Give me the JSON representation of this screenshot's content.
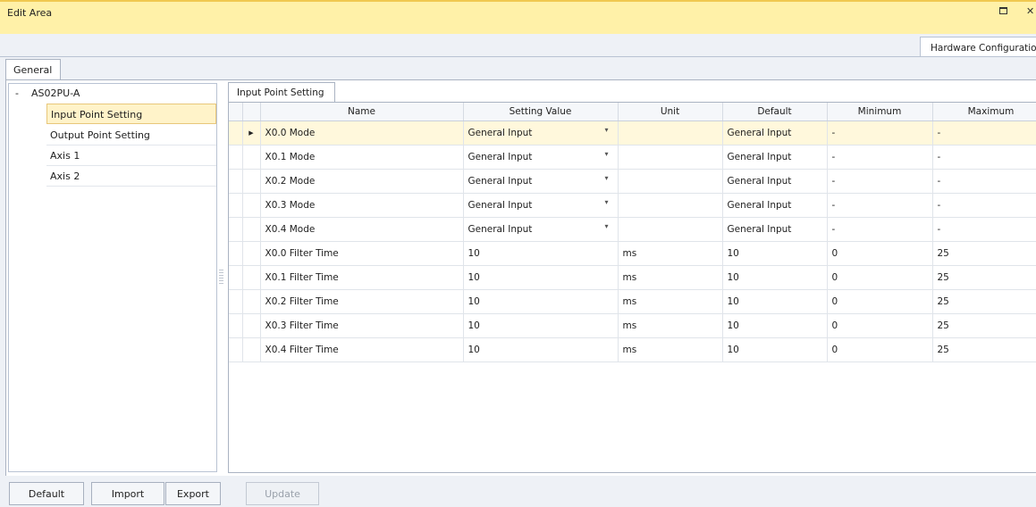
{
  "window": {
    "title": "Edit Area"
  },
  "area_tab": {
    "label": "Hardware Configuration"
  },
  "tabs": {
    "general": "General",
    "grid": "Input Point Setting"
  },
  "tree": {
    "root_label": "AS02PU-A",
    "expander": "-",
    "items": [
      {
        "label": "Input Point Setting",
        "selected": true
      },
      {
        "label": "Output Point Setting"
      },
      {
        "label": "Axis 1"
      },
      {
        "label": "Axis 2"
      }
    ]
  },
  "grid": {
    "columns": [
      "Name",
      "Setting Value",
      "Unit",
      "Default",
      "Minimum",
      "Maximum"
    ],
    "rows": [
      [
        "X0.0 Mode",
        "General Input",
        "",
        "General Input",
        "-",
        "-"
      ],
      [
        "X0.1 Mode",
        "General Input",
        "",
        "General Input",
        "-",
        "-"
      ],
      [
        "X0.2 Mode",
        "General Input",
        "",
        "General Input",
        "-",
        "-"
      ],
      [
        "X0.3 Mode",
        "General Input",
        "",
        "General Input",
        "-",
        "-"
      ],
      [
        "X0.4 Mode",
        "General Input",
        "",
        "General Input",
        "-",
        "-"
      ],
      [
        "X0.0 Filter Time",
        "10",
        "ms",
        "10",
        "0",
        "25"
      ],
      [
        "X0.1 Filter Time",
        "10",
        "ms",
        "10",
        "0",
        "25"
      ],
      [
        "X0.2 Filter Time",
        "10",
        "ms",
        "10",
        "0",
        "25"
      ],
      [
        "X0.3 Filter Time",
        "10",
        "ms",
        "10",
        "0",
        "25"
      ],
      [
        "X0.4 Filter Time",
        "10",
        "ms",
        "10",
        "0",
        "25"
      ]
    ],
    "dropdown_rows": [
      0,
      1,
      2,
      3,
      4
    ],
    "active_row": 0
  },
  "buttons": {
    "default": "Default",
    "import": "Import",
    "export": "Export",
    "update": "Update"
  },
  "icons": {
    "restore": "restore-icon",
    "close": "close-icon",
    "row_indicator": "row-indicator-icon",
    "dropdown": "dropdown-arrow-icon"
  },
  "colors": {
    "titlebar": "#fff1a8",
    "selected_row": "#fff8dc",
    "selected_tree_item": "#fff3c9"
  }
}
